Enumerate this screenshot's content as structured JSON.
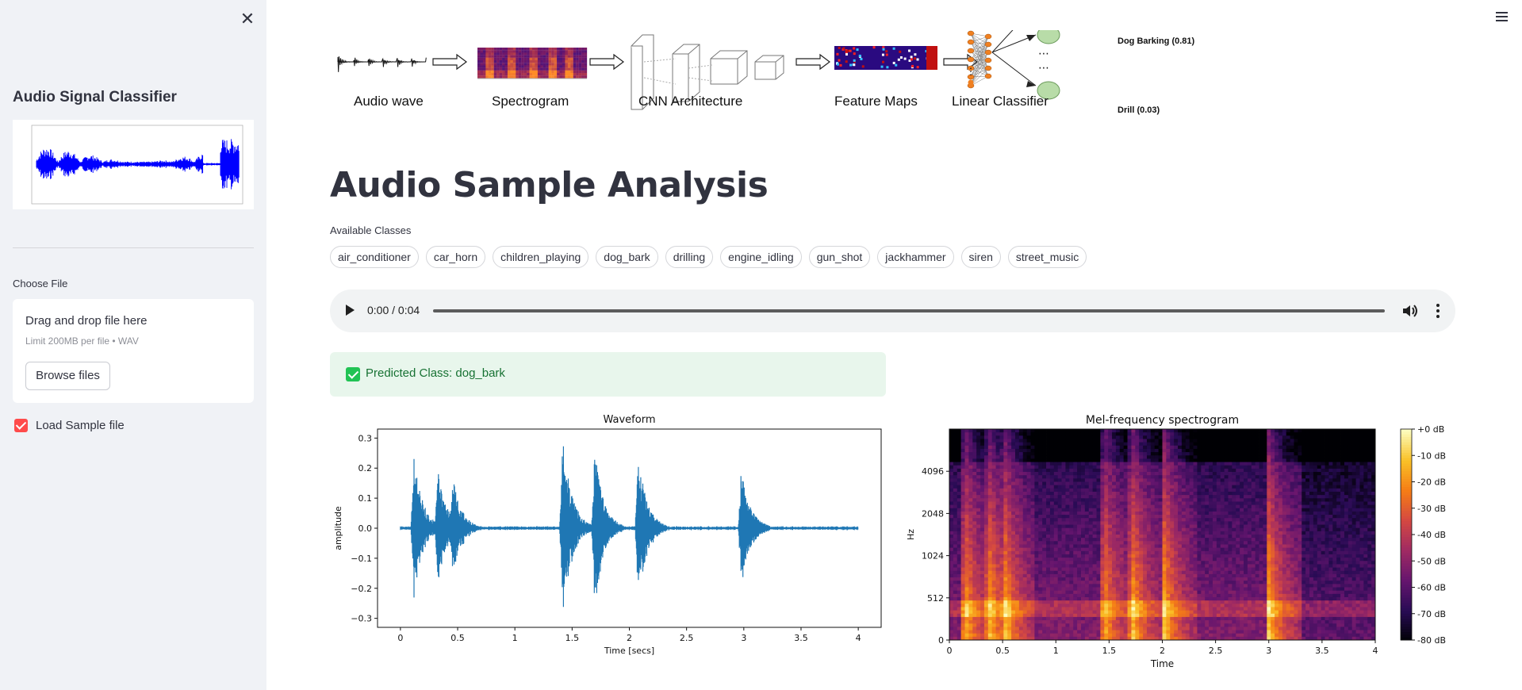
{
  "sidebar": {
    "title": "Audio Signal Classifier",
    "choose_file_label": "Choose File",
    "uploader": {
      "drag_text": "Drag and drop file here",
      "limit_text": "Limit 200MB per file • WAV",
      "browse_label": "Browse files"
    },
    "sample_checkbox": {
      "label": "Load Sample file",
      "checked": true
    }
  },
  "pipeline": {
    "stages": [
      "Audio wave",
      "Spectrogram",
      "CNN Architecture",
      "Feature Maps",
      "Linear Classifier"
    ],
    "outputs": [
      "Dog Barking (0.81)",
      "Drill  (0.03)"
    ]
  },
  "main": {
    "heading": "Audio Sample Analysis",
    "available_label": "Available Classes",
    "classes": [
      "air_conditioner",
      "car_horn",
      "children_playing",
      "dog_bark",
      "drilling",
      "engine_idling",
      "gun_shot",
      "jackhammer",
      "siren",
      "street_music"
    ],
    "audio_time": "0:00 / 0:04",
    "prediction": "Predicted Class: dog_bark"
  },
  "colors": {
    "accent": "#ff4b4b",
    "success_bg": "#e8f6ec",
    "success_text": "#177233",
    "waveform": "#1f77b4"
  },
  "chart_data": [
    {
      "type": "line",
      "title": "Waveform",
      "xlabel": "Time [secs]",
      "ylabel": "amplitude",
      "xlim": [
        -0.2,
        4.2
      ],
      "ylim": [
        -0.33,
        0.33
      ],
      "xticks": [
        "0",
        "0.5",
        "1",
        "1.5",
        "2",
        "2.5",
        "3",
        "3.5",
        "4"
      ],
      "yticks": [
        "0.3",
        "0.2",
        "0.1",
        "0.0",
        "−0.1",
        "−0.2",
        "−0.3"
      ],
      "bursts": [
        {
          "t": 0.12,
          "amp": 0.24
        },
        {
          "t": 0.33,
          "amp": 0.2
        },
        {
          "t": 0.46,
          "amp": 0.17
        },
        {
          "t": 1.42,
          "amp": 0.32
        },
        {
          "t": 1.7,
          "amp": 0.27
        },
        {
          "t": 2.08,
          "amp": 0.25
        },
        {
          "t": 2.98,
          "amp": 0.21
        }
      ]
    },
    {
      "type": "heatmap",
      "title": "Mel-frequency spectrogram",
      "xlabel": "Time",
      "ylabel": "Hz",
      "xticks": [
        "0",
        "0.5",
        "1",
        "1.5",
        "2",
        "2.5",
        "3",
        "3.5",
        "4"
      ],
      "yticks": [
        "4096",
        "2048",
        "1024",
        "512",
        "0"
      ],
      "colorbar_ticks": [
        "+0 dB",
        "-10 dB",
        "-20 dB",
        "-30 dB",
        "-40 dB",
        "-50 dB",
        "-60 dB",
        "-70 dB",
        "-80 dB"
      ],
      "colormap": "magma",
      "bursts_t": [
        0.12,
        0.35,
        0.5,
        1.42,
        1.7,
        2.0,
        2.98
      ]
    }
  ]
}
